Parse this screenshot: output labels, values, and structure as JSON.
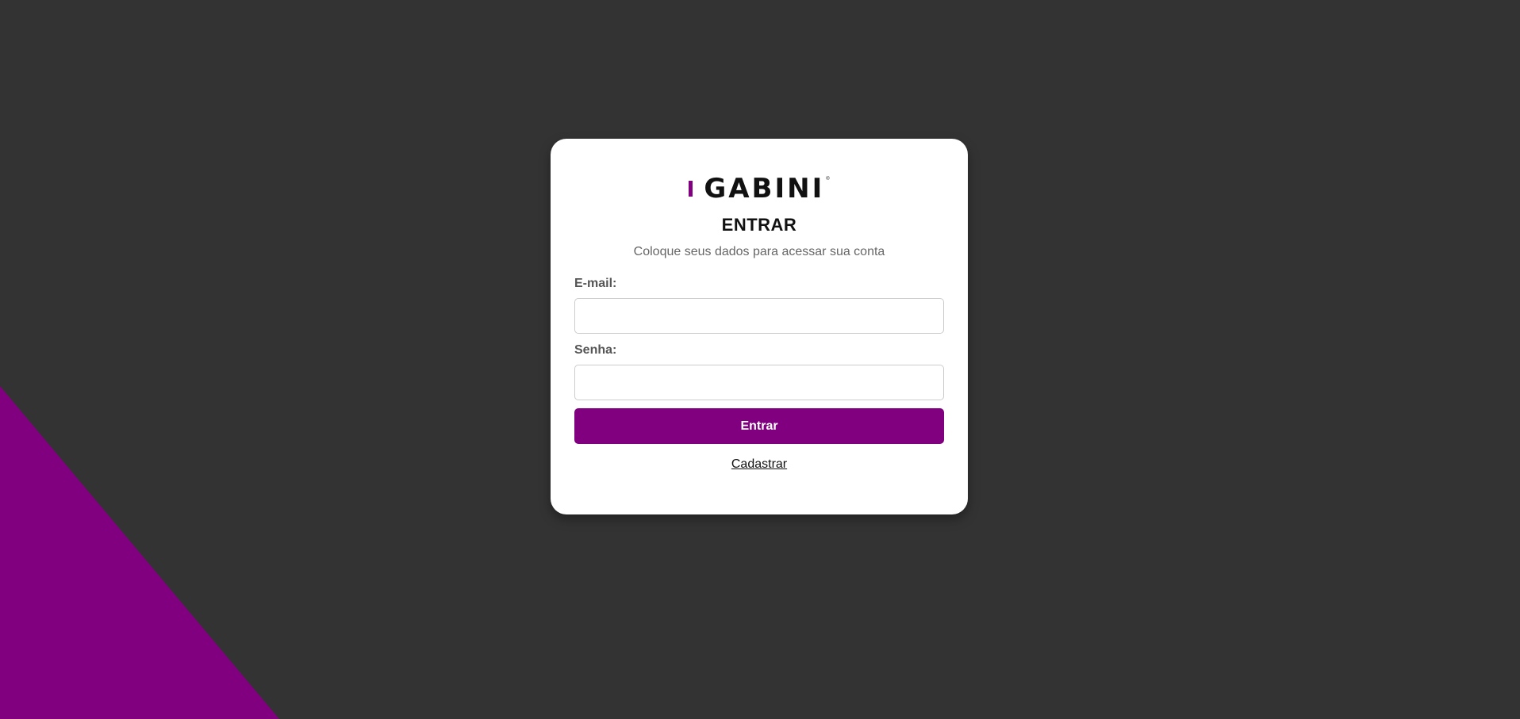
{
  "brand": {
    "logo_text": "GABINI",
    "logo_mark": "®",
    "accent_color": "#800080"
  },
  "login": {
    "title": "ENTRAR",
    "subtitle": "Coloque seus dados para acessar sua conta",
    "email_label": "E-mail:",
    "email_value": "",
    "email_placeholder": "",
    "password_label": "Senha:",
    "password_value": "",
    "password_placeholder": "",
    "submit_label": "Entrar",
    "register_link": "Cadastrar"
  },
  "theme": {
    "background": "#333333",
    "card_background": "#ffffff",
    "button_color": "#800080"
  }
}
